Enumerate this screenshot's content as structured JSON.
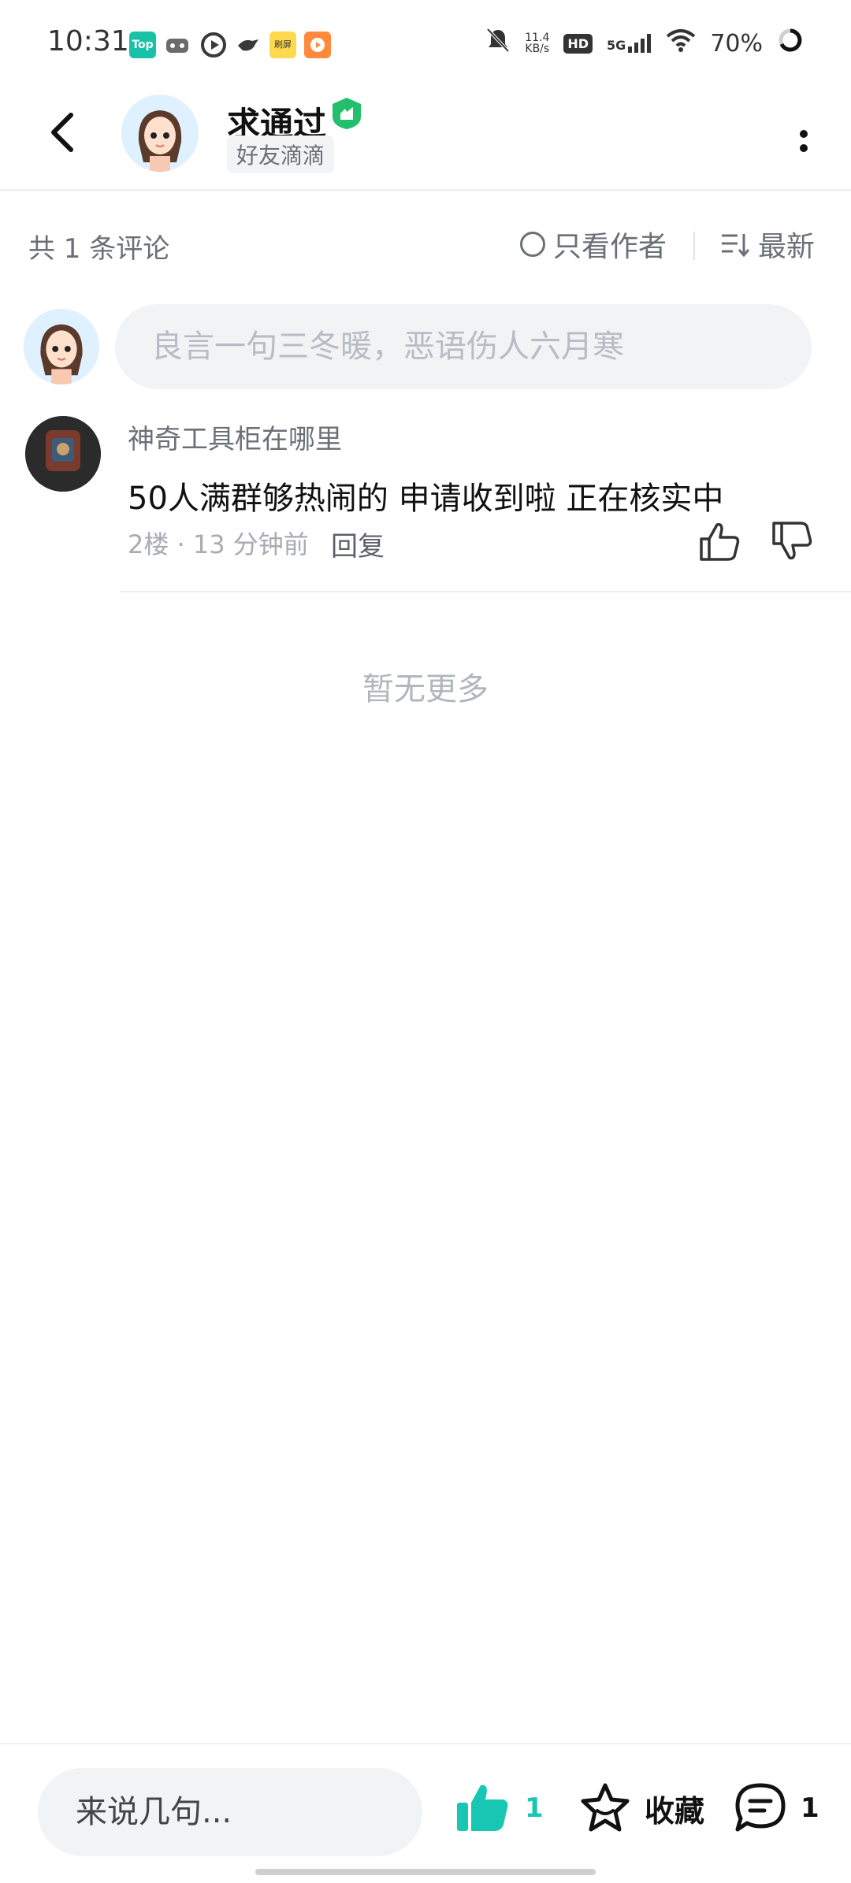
{
  "status_bar": {
    "time": "10:31",
    "app_icons": [
      {
        "name": "top-app-icon",
        "color": "#19c2a7",
        "label": "Top"
      },
      {
        "name": "game-controller-icon",
        "color": "#6b6b6b",
        "label": ""
      },
      {
        "name": "video-play-icon",
        "color": "#3a3a3a",
        "label": ""
      },
      {
        "name": "bird-icon",
        "color": "#3a3a3a",
        "label": ""
      },
      {
        "name": "yellow-app-icon",
        "color": "#ffd84d",
        "label": "刷屏"
      },
      {
        "name": "orange-app-icon",
        "color": "#ff8a3d",
        "label": ""
      }
    ],
    "net_speed": "11.4",
    "net_speed_unit": "KB/s",
    "hd_label": "HD",
    "signal_label": "5G",
    "battery": "70%"
  },
  "header": {
    "title": "求通过",
    "subtitle": "好友滴滴"
  },
  "filter": {
    "count_label": "共 1 条评论",
    "only_author_label": "只看作者",
    "sort_label": "最新"
  },
  "comment_input": {
    "placeholder": "良言一句三冬暖，恶语伤人六月寒"
  },
  "comments": [
    {
      "username": "神奇工具柜在哪里",
      "text": "50人满群够热闹的 申请收到啦 正在核实中",
      "meta": "2楼 · 13 分钟前",
      "reply_label": "回复"
    }
  ],
  "no_more_label": "暂无更多",
  "bottom_bar": {
    "say_placeholder": "来说几句...",
    "like_count": "1",
    "collect_label": "收藏",
    "comment_count": "1"
  },
  "colors": {
    "accent": "#17c6b3",
    "verified": "#22c06c"
  }
}
